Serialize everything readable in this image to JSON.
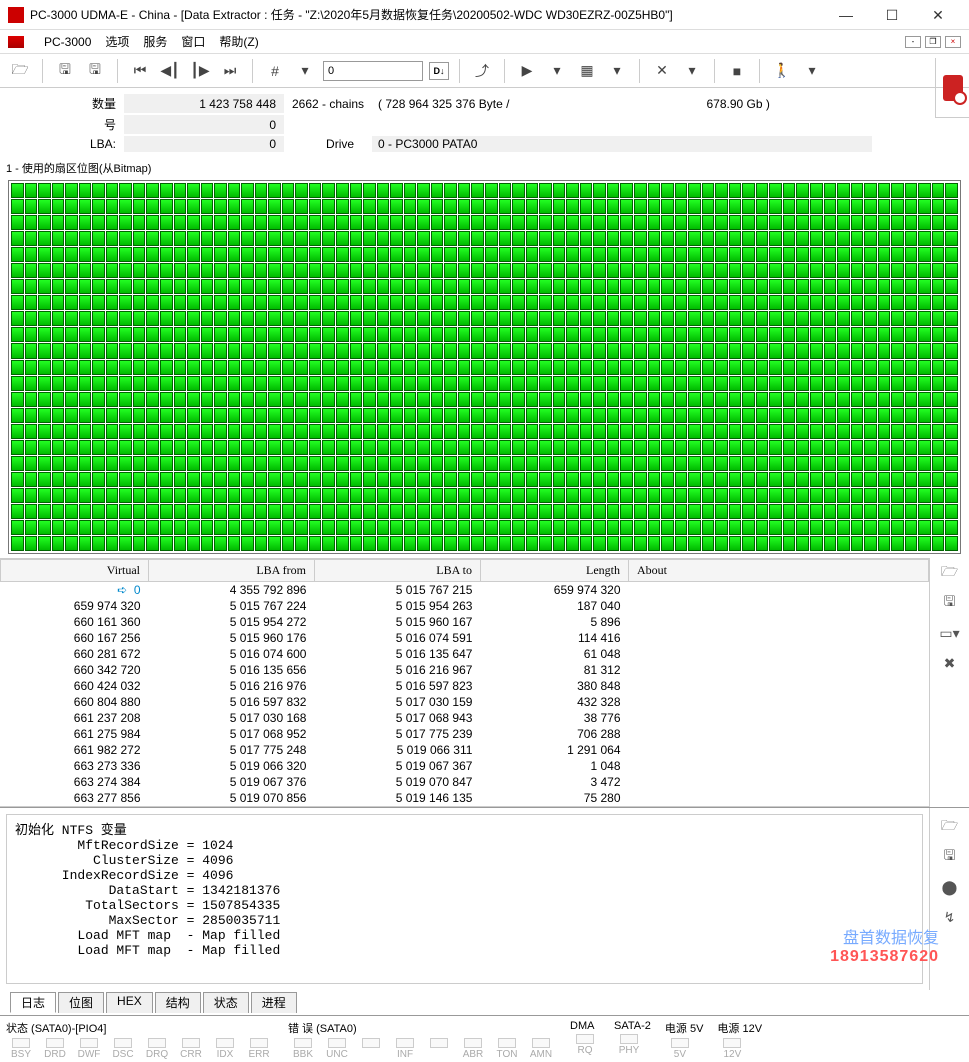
{
  "window": {
    "title": "PC-3000 UDMA-E - China - [Data Extractor : 任务 - \"Z:\\2020年5月数据恢复任务\\20200502-WDC WD30EZRZ-00Z5HB0\"]"
  },
  "menu": {
    "app": "PC-3000",
    "items": [
      "选项",
      "服务",
      "窗口",
      "帮助(Z)"
    ]
  },
  "toolbar": {
    "input_value": "0",
    "badge": "D↓"
  },
  "info": {
    "count_label": "数量",
    "count_value": "1 423 758 448",
    "chains": "2662 - chains",
    "bytes": "( 728 964 325 376 Byte /",
    "gb": "678.90 Gb )",
    "num_label": "号",
    "num_value": "0",
    "lba_label": "LBA:",
    "lba_value": "0",
    "drive_label": "Drive",
    "drive_value": "0 - PC3000 PATA0"
  },
  "bitmap": {
    "title": "1 - 使用的扇区位图(从Bitmap)"
  },
  "table": {
    "headers": [
      "Virtual",
      "LBA from",
      "LBA to",
      "Length",
      "About"
    ],
    "rows": [
      [
        "0",
        "4 355 792 896",
        "5 015 767 215",
        "659 974 320",
        ""
      ],
      [
        "659 974 320",
        "5 015 767 224",
        "5 015 954 263",
        "187 040",
        ""
      ],
      [
        "660 161 360",
        "5 015 954 272",
        "5 015 960 167",
        "5 896",
        ""
      ],
      [
        "660 167 256",
        "5 015 960 176",
        "5 016 074 591",
        "114 416",
        ""
      ],
      [
        "660 281 672",
        "5 016 074 600",
        "5 016 135 647",
        "61 048",
        ""
      ],
      [
        "660 342 720",
        "5 016 135 656",
        "5 016 216 967",
        "81 312",
        ""
      ],
      [
        "660 424 032",
        "5 016 216 976",
        "5 016 597 823",
        "380 848",
        ""
      ],
      [
        "660 804 880",
        "5 016 597 832",
        "5 017 030 159",
        "432 328",
        ""
      ],
      [
        "661 237 208",
        "5 017 030 168",
        "5 017 068 943",
        "38 776",
        ""
      ],
      [
        "661 275 984",
        "5 017 068 952",
        "5 017 775 239",
        "706 288",
        ""
      ],
      [
        "661 982 272",
        "5 017 775 248",
        "5 019 066 311",
        "1 291 064",
        ""
      ],
      [
        "663 273 336",
        "5 019 066 320",
        "5 019 067 367",
        "1 048",
        ""
      ],
      [
        "663 274 384",
        "5 019 067 376",
        "5 019 070 847",
        "3 472",
        ""
      ],
      [
        "663 277 856",
        "5 019 070 856",
        "5 019 146 135",
        "75 280",
        ""
      ]
    ]
  },
  "log": {
    "lines": [
      "初始化 NTFS 变量",
      "        MftRecordSize = 1024",
      "          ClusterSize = 4096",
      "      IndexRecordSize = 4096",
      "            DataStart = 1342181376",
      "         TotalSectors = 1507854335",
      "            MaxSector = 2850035711",
      "        Load MFT map  - Map filled",
      "        Load MFT map  - Map filled"
    ]
  },
  "bottom_tabs": [
    "日志",
    "位图",
    "HEX",
    "结构",
    "状态",
    "进程"
  ],
  "status": {
    "g1": {
      "title": "状态 (SATA0)-[PIO4]",
      "leds": [
        "BSY",
        "DRD",
        "DWF",
        "DSC",
        "DRQ",
        "CRR",
        "IDX",
        "ERR"
      ]
    },
    "g2": {
      "title": "错 误 (SATA0)",
      "leds": [
        "BBK",
        "UNC",
        "",
        "INF",
        "",
        "ABR",
        "TON",
        "AMN"
      ]
    },
    "g3": {
      "title": "DMA",
      "leds": [
        "RQ"
      ]
    },
    "g4": {
      "title": "SATA-2",
      "leds": [
        "PHY"
      ]
    },
    "g5": {
      "title": "电源 5V",
      "leds": [
        "5V"
      ]
    },
    "g6": {
      "title": "电源 12V",
      "leds": [
        "12V"
      ]
    }
  },
  "watermark": {
    "l1": "盘首数据恢复",
    "l2": "18913587620"
  }
}
